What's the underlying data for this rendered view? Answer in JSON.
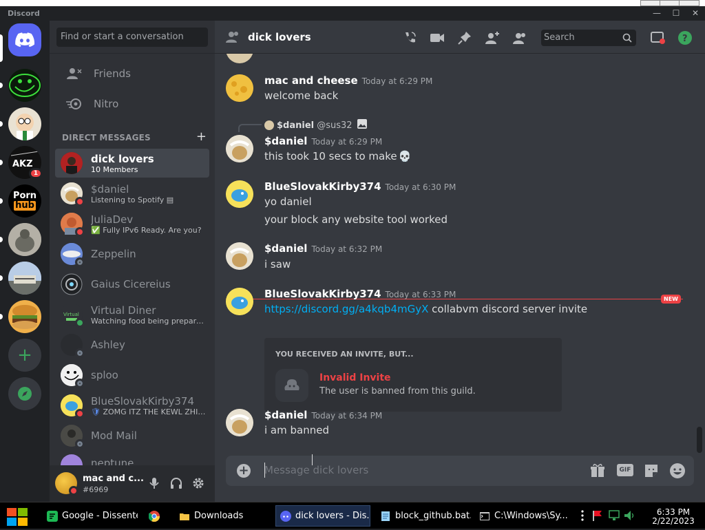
{
  "app": {
    "title": "Discord"
  },
  "sidebar": {
    "search_placeholder": "Find or start a conversation",
    "nav": [
      {
        "label": "Friends"
      },
      {
        "label": "Nitro"
      }
    ],
    "dm_header": "DIRECT MESSAGES",
    "dms": [
      {
        "name": "dick lovers",
        "sub": "10 Members",
        "status": ""
      },
      {
        "name": "$daniel",
        "sub": "Listening to Spotify",
        "status": "dnd"
      },
      {
        "name": "JuliaDev",
        "sub": "✅ Fully IPv6 Ready. Are you?",
        "status": "dnd"
      },
      {
        "name": "Zeppelin",
        "sub": "",
        "status": "offline"
      },
      {
        "name": "Gaius Cicereius",
        "sub": "",
        "status": ""
      },
      {
        "name": "Virtual Diner",
        "sub": "Watching food being prepared!",
        "status": "online"
      },
      {
        "name": "Ashley",
        "sub": "",
        "status": "offline"
      },
      {
        "name": "sploo",
        "sub": "",
        "status": "offline"
      },
      {
        "name": "BlueSlovakKirby374",
        "sub": "ZOMG ITZ THE KEWL ZHIE...",
        "status": "dnd"
      },
      {
        "name": "Mod Mail",
        "sub": "",
        "status": "offline"
      },
      {
        "name": "neptune",
        "sub": "",
        "status": ""
      }
    ]
  },
  "guilds": {
    "porn_line1": "Porn",
    "porn_line2": "hub",
    "mention_badge": "1"
  },
  "user": {
    "name": "mac and c...",
    "tag": "#6969"
  },
  "channel": {
    "name": "dick lovers",
    "search_placeholder": "Search"
  },
  "messages": [
    {
      "author": "mac and cheese",
      "time": "Today at 6:29 PM",
      "lines": [
        "welcome back"
      ]
    },
    {
      "reply_author": "$daniel",
      "reply_text": "@sus32",
      "author": "$daniel",
      "time": "Today at 6:29 PM",
      "lines": [
        "this took 10 secs to make"
      ]
    },
    {
      "author": "BlueSlovakKirby374",
      "time": "Today at 6:30 PM",
      "lines": [
        "yo daniel",
        "your block any website tool worked"
      ]
    },
    {
      "author": "$daniel",
      "time": "Today at 6:32 PM",
      "lines": [
        "i saw"
      ]
    },
    {
      "author": "BlueSlovakKirby374",
      "time": "Today at 6:33 PM",
      "link": "https://discord.gg/a4kqb4mGyX",
      "lines": [
        "collabvm discord server invite"
      ]
    },
    {
      "author": "$daniel",
      "time": "Today at 6:34 PM",
      "lines": [
        "i am banned"
      ]
    }
  ],
  "new_divider": "NEW",
  "invite": {
    "header": "YOU RECEIVED AN INVITE, BUT...",
    "title": "Invalid Invite",
    "desc": "The user is banned from this guild."
  },
  "composer": {
    "placeholder": "Message dick lovers",
    "gif_label": "GIF"
  },
  "taskbar": {
    "items": [
      {
        "label": "Google - Dissenter"
      },
      {
        "label": ""
      },
      {
        "label": "Downloads"
      },
      {
        "label": "dick lovers - Dis..."
      },
      {
        "label": "block_github.bat..."
      },
      {
        "label": "C:\\Windows\\Sy..."
      }
    ],
    "time": "6:33 PM",
    "date": "2/22/2023"
  },
  "colors": {
    "blurple": "#5865f2",
    "dnd": "#ed4245",
    "online": "#3ba55d",
    "link": "#00aff4",
    "bg": "#36393f"
  }
}
